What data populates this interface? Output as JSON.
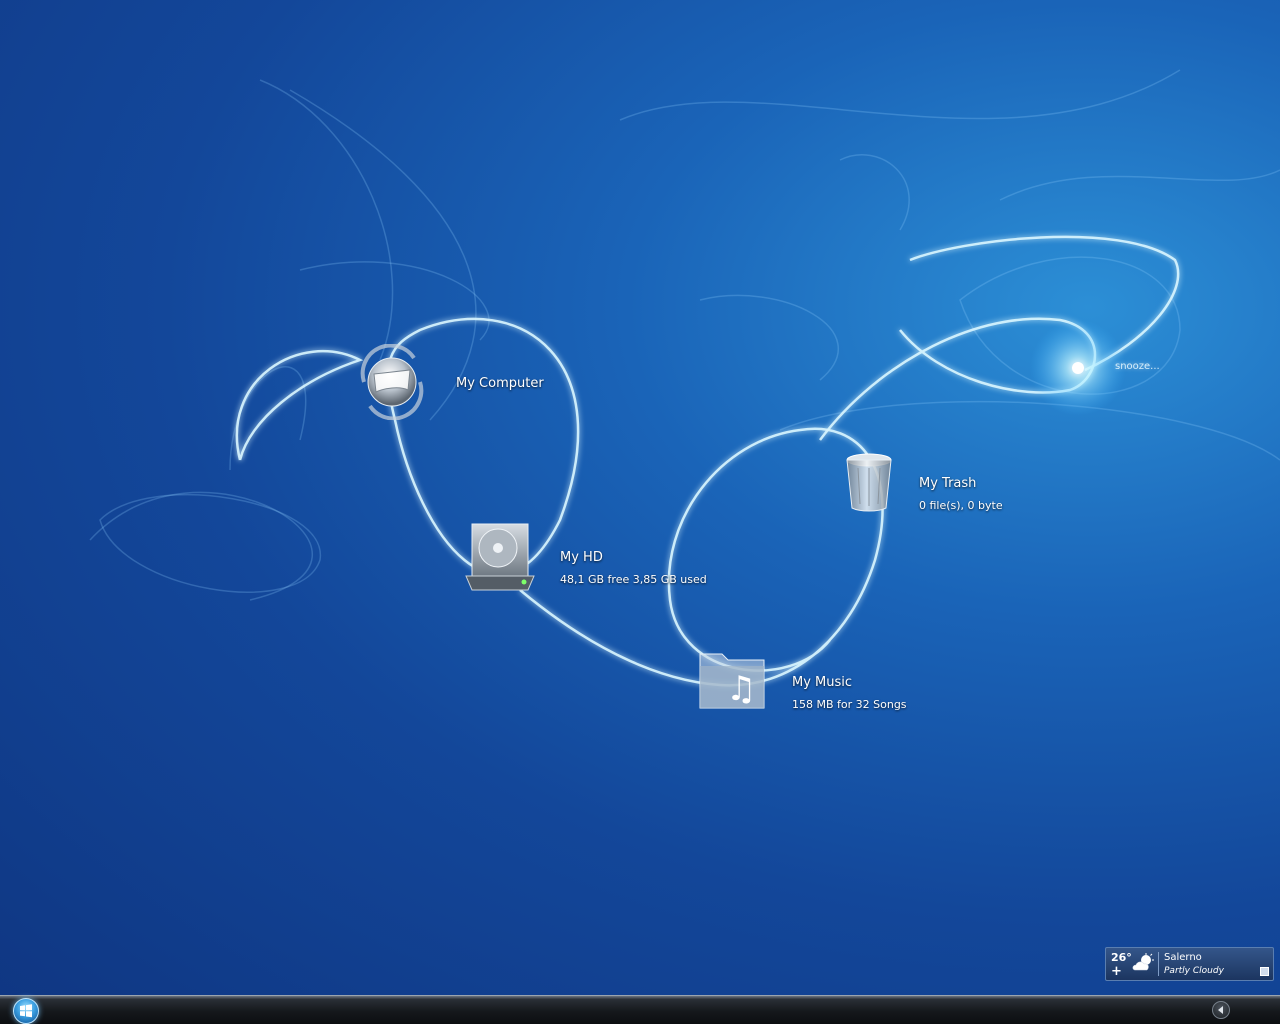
{
  "desktop": {
    "icons": [
      {
        "label": "My Computer",
        "sub": ""
      },
      {
        "label": "My HD",
        "sub": "48,1 GB free 3,85 GB used"
      },
      {
        "label": "My Music",
        "sub": "158 MB for 32 Songs"
      },
      {
        "label": "My Trash",
        "sub": "0 file(s), 0 byte"
      }
    ],
    "snooze_text": "snooze..."
  },
  "weather_gadget": {
    "temperature": "26°",
    "add_symbol": "+",
    "city": "Salerno",
    "condition": "Partly Cloudy",
    "icon": "partly-cloudy-icon"
  },
  "taskbar": {
    "start_icon": "windows-logo-icon",
    "tray_icon": "show-hidden-icons-arrow-icon"
  },
  "colors": {
    "background": "#13479a",
    "glow": "#bfefff",
    "text": "#ffffff"
  }
}
